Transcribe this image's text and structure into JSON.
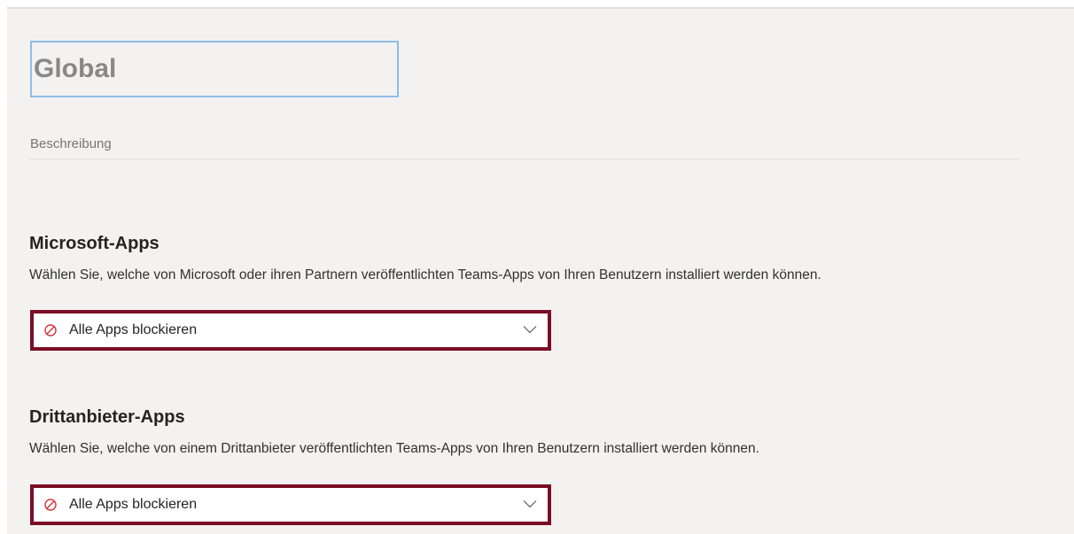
{
  "policy": {
    "name_value": "Global",
    "description_placeholder": "Beschreibung"
  },
  "microsoft_apps": {
    "title": "Microsoft-Apps",
    "description": "Wählen Sie, welche von Microsoft oder ihren Partnern veröffentlichten Teams-Apps von Ihren Benutzern installiert werden können.",
    "dropdown": {
      "selected_label": "Alle Apps blockieren",
      "icon": "block-icon"
    }
  },
  "third_party_apps": {
    "title": "Drittanbieter-Apps",
    "description": "Wählen Sie, welche von einem Drittanbieter veröffentlichten Teams-Apps von Ihren Benutzern installiert werden können.",
    "dropdown": {
      "selected_label": "Alle Apps blockieren",
      "icon": "block-icon"
    }
  },
  "colors": {
    "highlight_border": "#7a0d24",
    "block_icon": "#d13438",
    "focus_border": "#8fbbe6",
    "panel_background": "#f3f2f1"
  }
}
